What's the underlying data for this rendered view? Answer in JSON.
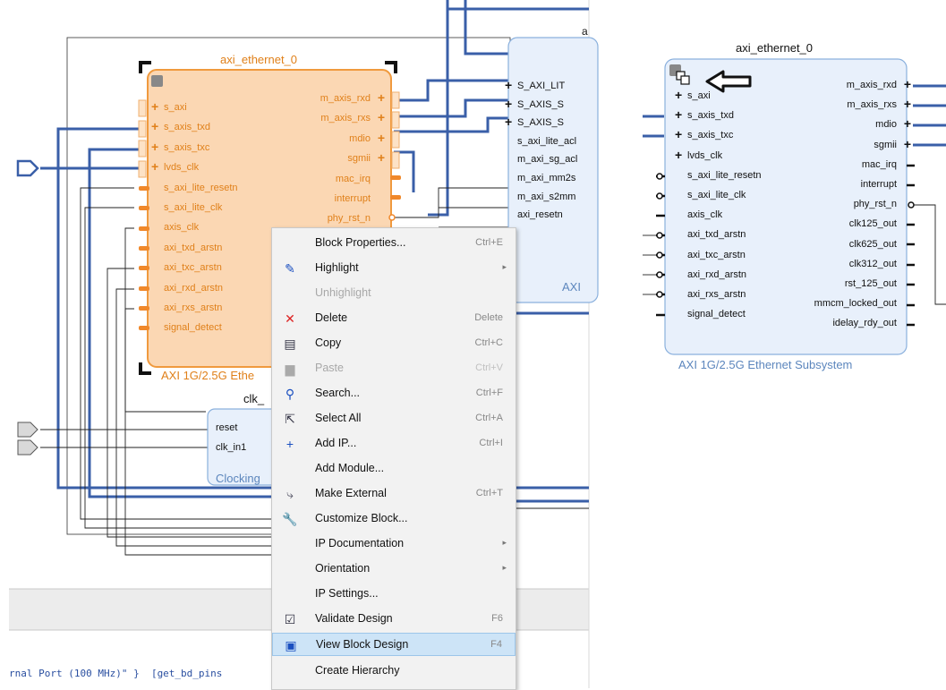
{
  "left_block": {
    "title": "axi_ethernet_0",
    "subtitle": "AXI 1G/2.5G Ethe",
    "left_pins": [
      "s_axi",
      "s_axis_txd",
      "s_axis_txc",
      "lvds_clk",
      "s_axi_lite_resetn",
      "s_axi_lite_clk",
      "axis_clk",
      "axi_txd_arstn",
      "axi_txc_arstn",
      "axi_rxd_arstn",
      "axi_rxs_arstn",
      "signal_detect"
    ],
    "right_pins": [
      "m_axis_rxd",
      "m_axis_rxs",
      "mdio",
      "sgmii",
      "mac_irq",
      "interrupt",
      "phy_rst_n"
    ]
  },
  "dma_block": {
    "title_fragment": "a",
    "pins": [
      "S_AXI_LIT",
      "S_AXIS_S",
      "S_AXIS_S",
      "s_axi_lite_acl",
      "m_axi_sg_acl",
      "m_axi_mm2s",
      "m_axi_s2mm",
      "axi_resetn"
    ],
    "subtitle": "AXI"
  },
  "clk_block": {
    "title": "clk_",
    "pins": [
      "reset",
      "clk_in1"
    ],
    "subtitle": "Clocking"
  },
  "console": {
    "line": "rnal Port (100 MHz)\" }  [get_bd_pins"
  },
  "context_menu": {
    "items": [
      {
        "label": "Block Properties...",
        "shortcut": "Ctrl+E",
        "icon": "",
        "state": "normal"
      },
      {
        "label": "Highlight",
        "shortcut": "",
        "icon": "highlight-icon",
        "state": "submenu"
      },
      {
        "label": "Unhighlight",
        "shortcut": "",
        "icon": "",
        "state": "disabled"
      },
      {
        "label": "Delete",
        "shortcut": "Delete",
        "icon": "delete-icon",
        "state": "normal"
      },
      {
        "label": "Copy",
        "shortcut": "Ctrl+C",
        "icon": "copy-icon",
        "state": "normal"
      },
      {
        "label": "Paste",
        "shortcut": "Ctrl+V",
        "icon": "paste-icon",
        "state": "disabled"
      },
      {
        "label": "Search...",
        "shortcut": "Ctrl+F",
        "icon": "search-icon",
        "state": "normal"
      },
      {
        "label": "Select All",
        "shortcut": "Ctrl+A",
        "icon": "select-all-icon",
        "state": "normal"
      },
      {
        "label": "Add IP...",
        "shortcut": "Ctrl+I",
        "icon": "add-icon",
        "state": "normal"
      },
      {
        "label": "Add Module...",
        "shortcut": "",
        "icon": "",
        "state": "normal"
      },
      {
        "label": "Make External",
        "shortcut": "Ctrl+T",
        "icon": "make-external-icon",
        "state": "normal"
      },
      {
        "label": "Customize Block...",
        "shortcut": "",
        "icon": "wrench-icon",
        "state": "normal"
      },
      {
        "label": "IP Documentation",
        "shortcut": "",
        "icon": "",
        "state": "submenu"
      },
      {
        "label": "Orientation",
        "shortcut": "",
        "icon": "",
        "state": "submenu"
      },
      {
        "label": "IP Settings...",
        "shortcut": "",
        "icon": "",
        "state": "normal"
      },
      {
        "label": "Validate Design",
        "shortcut": "F6",
        "icon": "validate-icon",
        "state": "normal"
      },
      {
        "label": "View Block Design",
        "shortcut": "F4",
        "icon": "view-block-design-icon",
        "state": "selected"
      },
      {
        "label": "Create Hierarchy",
        "shortcut": "",
        "icon": "",
        "state": "normal"
      }
    ]
  },
  "right_block": {
    "title": "axi_ethernet_0",
    "subtitle": "AXI 1G/2.5G Ethernet Subsystem",
    "left_pins": [
      "s_axi",
      "s_axis_txd",
      "s_axis_txc",
      "lvds_clk",
      "s_axi_lite_resetn",
      "s_axi_lite_clk",
      "axis_clk",
      "axi_txd_arstn",
      "axi_txc_arstn",
      "axi_rxd_arstn",
      "axi_rxs_arstn",
      "signal_detect"
    ],
    "right_pins": [
      "m_axis_rxd",
      "m_axis_rxs",
      "mdio",
      "sgmii",
      "mac_irq",
      "interrupt",
      "phy_rst_n",
      "clk125_out",
      "clk625_out",
      "clk312_out",
      "rst_125_out",
      "mmcm_locked_out",
      "idelay_rdy_out"
    ]
  },
  "colors": {
    "net_blue": "#3a5fa8",
    "block_orange_fill": "#fbd7b3",
    "block_orange_border": "#f09a3e",
    "pin_orange": "#f0882a",
    "block_blue_fill": "#e8f0fb",
    "block_blue_border": "#8ab0dd",
    "menu_selected": "#cde4f7"
  }
}
